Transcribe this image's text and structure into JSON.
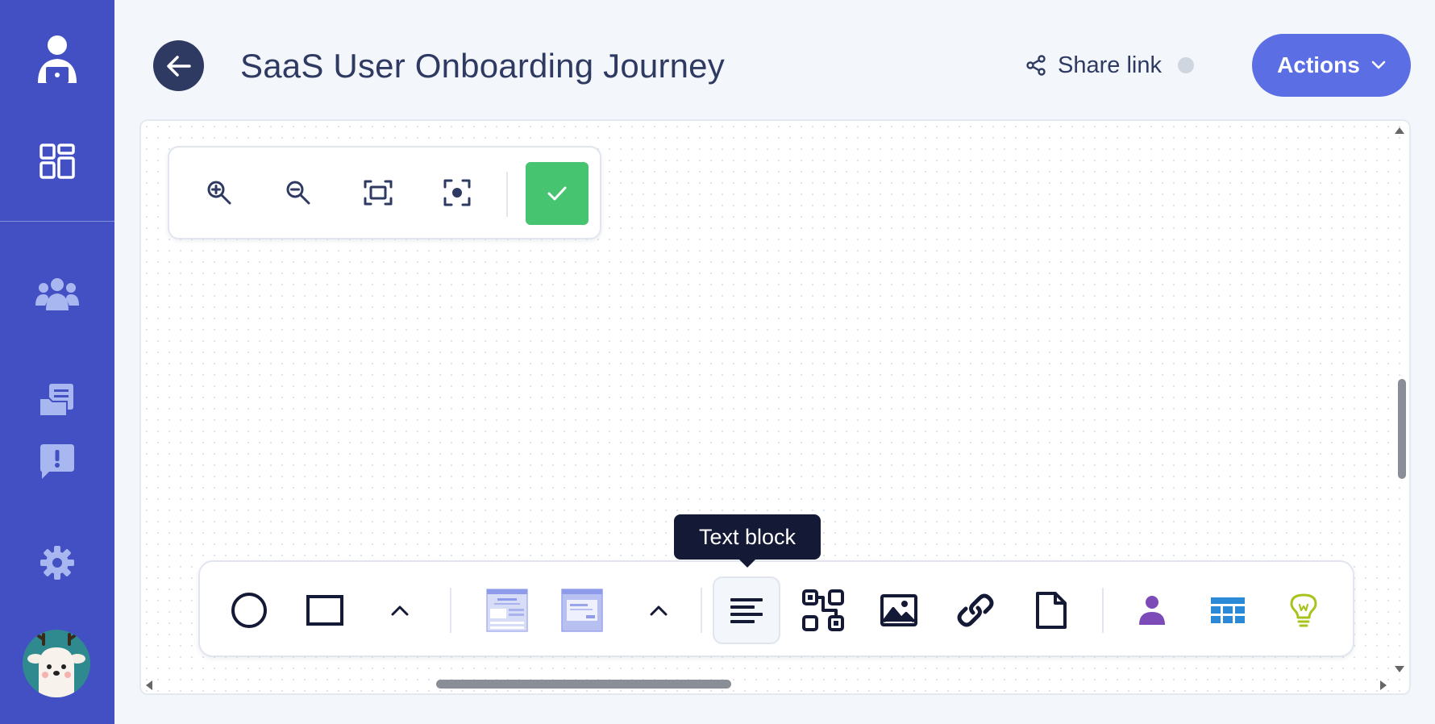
{
  "app": {
    "title": "SaaS User Onboarding Journey"
  },
  "sidebar": {
    "items": [
      {
        "icon": "user-laptop-icon"
      },
      {
        "icon": "dashboard-icon"
      },
      {
        "icon": "team-icon"
      },
      {
        "icon": "documents-icon"
      },
      {
        "icon": "feedback-icon"
      },
      {
        "icon": "gear-icon"
      }
    ],
    "avatar_icon": "deer-avatar"
  },
  "header": {
    "share_label": "Share link",
    "actions_label": "Actions"
  },
  "zoom_toolbar": {
    "buttons": [
      "zoom-in-icon",
      "zoom-out-icon",
      "fit-to-screen-icon",
      "center-icon",
      "check-icon"
    ]
  },
  "shape_toolbar": {
    "tooltip": "Text block",
    "tools": [
      {
        "icon": "circle-icon"
      },
      {
        "icon": "rectangle-icon"
      },
      {
        "icon": "chevron-up-icon"
      },
      {
        "icon": "wireframe-page-icon"
      },
      {
        "icon": "wireframe-dialog-icon"
      },
      {
        "icon": "chevron-up-icon"
      },
      {
        "icon": "text-block-icon"
      },
      {
        "icon": "qr-flow-icon"
      },
      {
        "icon": "image-icon"
      },
      {
        "icon": "link-icon"
      },
      {
        "icon": "document-icon"
      },
      {
        "icon": "persona-icon"
      },
      {
        "icon": "table-icon"
      },
      {
        "icon": "lightbulb-icon"
      }
    ]
  },
  "colors": {
    "sidebar": "#4350c4",
    "accent": "#5b6ee4",
    "confirm": "#47c470",
    "tooltip_bg": "#141a35",
    "title_text": "#2f3a63"
  }
}
